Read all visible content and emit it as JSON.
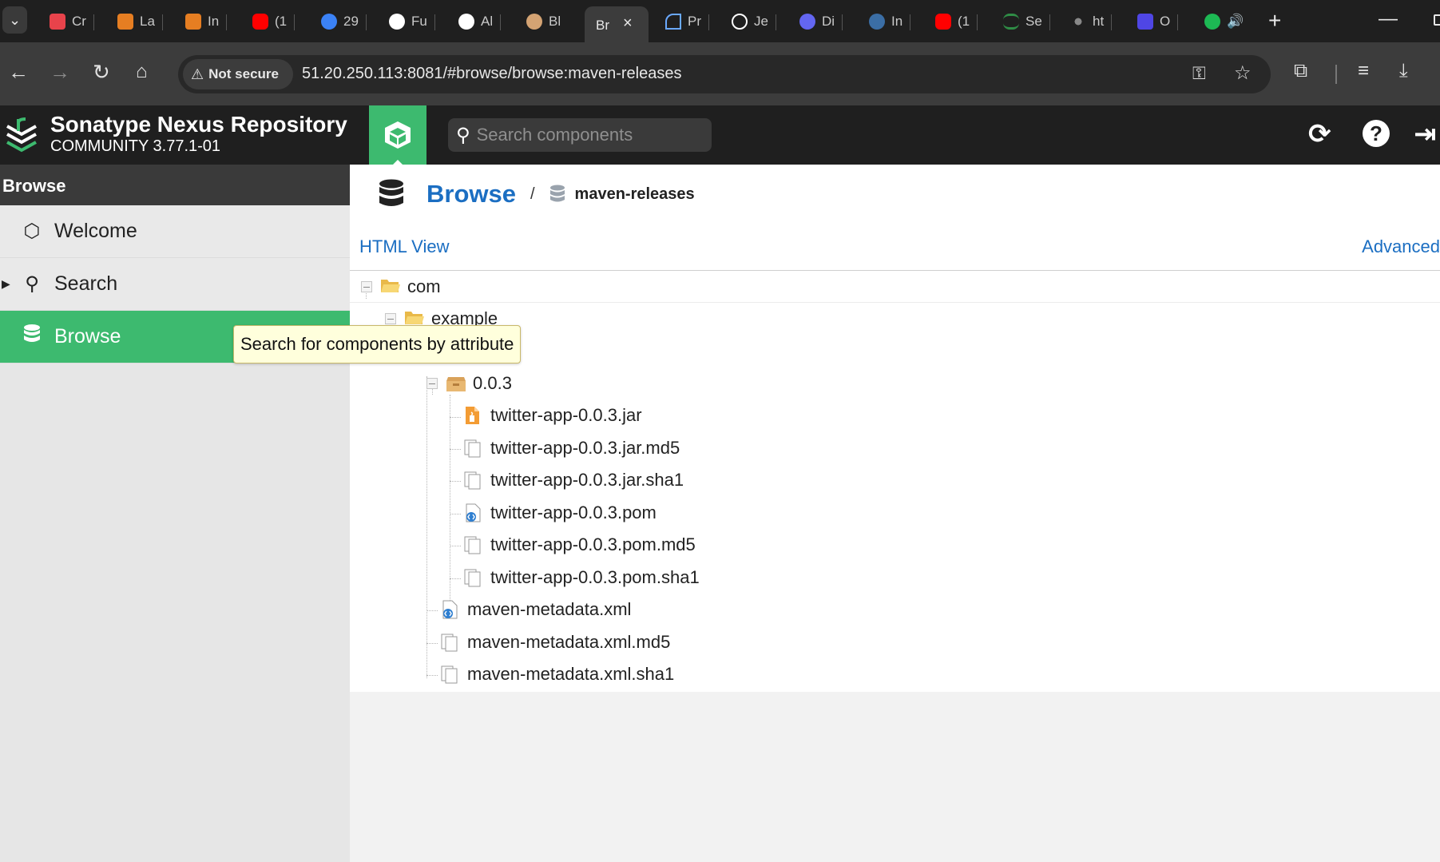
{
  "browser": {
    "tabs": [
      {
        "label": "Cr",
        "color": "#e8434b"
      },
      {
        "label": "La",
        "color": "#e67e22"
      },
      {
        "label": "In",
        "color": "#e67e22"
      },
      {
        "label": "(1",
        "color": "#ff0000"
      },
      {
        "label": "29",
        "color": "#3b82f6"
      },
      {
        "label": "Fu",
        "color": "#ffffff"
      },
      {
        "label": "Al",
        "color": "#ffffff"
      },
      {
        "label": "Bl",
        "color": "#d4a373"
      },
      {
        "label": "Pr",
        "color": "#6aa9ff"
      },
      {
        "label": "Je",
        "color": "#ffffff"
      },
      {
        "label": "Di",
        "color": "#6366f1"
      },
      {
        "label": "In",
        "color": "#3b6ea5"
      },
      {
        "label": "(1",
        "color": "#ff0000"
      },
      {
        "label": "Se",
        "color": "#2f8d46"
      },
      {
        "label": "ht",
        "color": "#888888"
      },
      {
        "label": "O",
        "color": "#4f46e5"
      }
    ],
    "active_tab": {
      "label": "Br",
      "close": "×"
    },
    "new_tab": "+",
    "security_label": "Not secure",
    "url": "51.20.250.113:8081/#browse/browse:maven-releases"
  },
  "nexus": {
    "title": "Sonatype Nexus Repository",
    "version": "COMMUNITY 3.77.1-01",
    "search_placeholder": "Search components",
    "accent": "#3dba6f",
    "link_color": "#1b6ec2"
  },
  "sidebar": {
    "header": "Browse",
    "items": [
      {
        "label": "Welcome",
        "icon": "hexagon-icon"
      },
      {
        "label": "Search",
        "icon": "search-icon"
      },
      {
        "label": "Browse",
        "icon": "database-icon"
      }
    ]
  },
  "tooltip": "Search for components by attribute",
  "main": {
    "breadcrumb_title": "Browse",
    "breadcrumb_sep": "/",
    "repository": "maven-releases",
    "html_view": "HTML View",
    "advanced": "Advanced"
  },
  "tree": [
    {
      "label": "com",
      "type": "folder"
    },
    {
      "label": "example",
      "type": "folder"
    },
    {
      "label": "",
      "type": "folder"
    },
    {
      "label": "0.0.3",
      "type": "component"
    },
    {
      "label": "twitter-app-0.0.3.jar",
      "type": "jar"
    },
    {
      "label": "twitter-app-0.0.3.jar.md5",
      "type": "file"
    },
    {
      "label": "twitter-app-0.0.3.jar.sha1",
      "type": "file"
    },
    {
      "label": "twitter-app-0.0.3.pom",
      "type": "xml"
    },
    {
      "label": "twitter-app-0.0.3.pom.md5",
      "type": "file"
    },
    {
      "label": "twitter-app-0.0.3.pom.sha1",
      "type": "file"
    },
    {
      "label": "maven-metadata.xml",
      "type": "xml"
    },
    {
      "label": "maven-metadata.xml.md5",
      "type": "file"
    },
    {
      "label": "maven-metadata.xml.sha1",
      "type": "file"
    }
  ]
}
